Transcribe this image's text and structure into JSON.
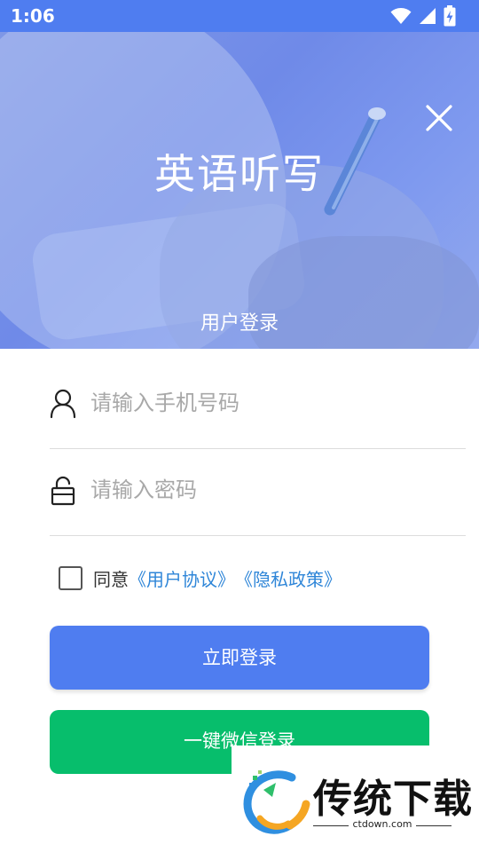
{
  "status_bar": {
    "time": "1:06"
  },
  "hero": {
    "app_title": "英语听写",
    "section_title": "用户登录"
  },
  "form": {
    "phone_placeholder": "请输入手机号码",
    "phone_value": "",
    "password_placeholder": "请输入密码",
    "password_value": "",
    "agree_prefix": "同意",
    "user_agreement_link": "《用户协议》",
    "privacy_policy_link": "《隐私政策》",
    "agree_checked": false
  },
  "buttons": {
    "login_label": "立即登录",
    "wechat_login_label": "一键微信登录"
  },
  "watermark": {
    "brand_text": "传统下载",
    "brand_domain": "ctdown.com"
  },
  "colors": {
    "accent": "#4f7df0",
    "wechat_green": "#07be6c",
    "link_blue": "#2f86d8"
  },
  "icons": {
    "phone_field": "user-icon",
    "password_field": "lock-icon",
    "close": "close-icon"
  }
}
